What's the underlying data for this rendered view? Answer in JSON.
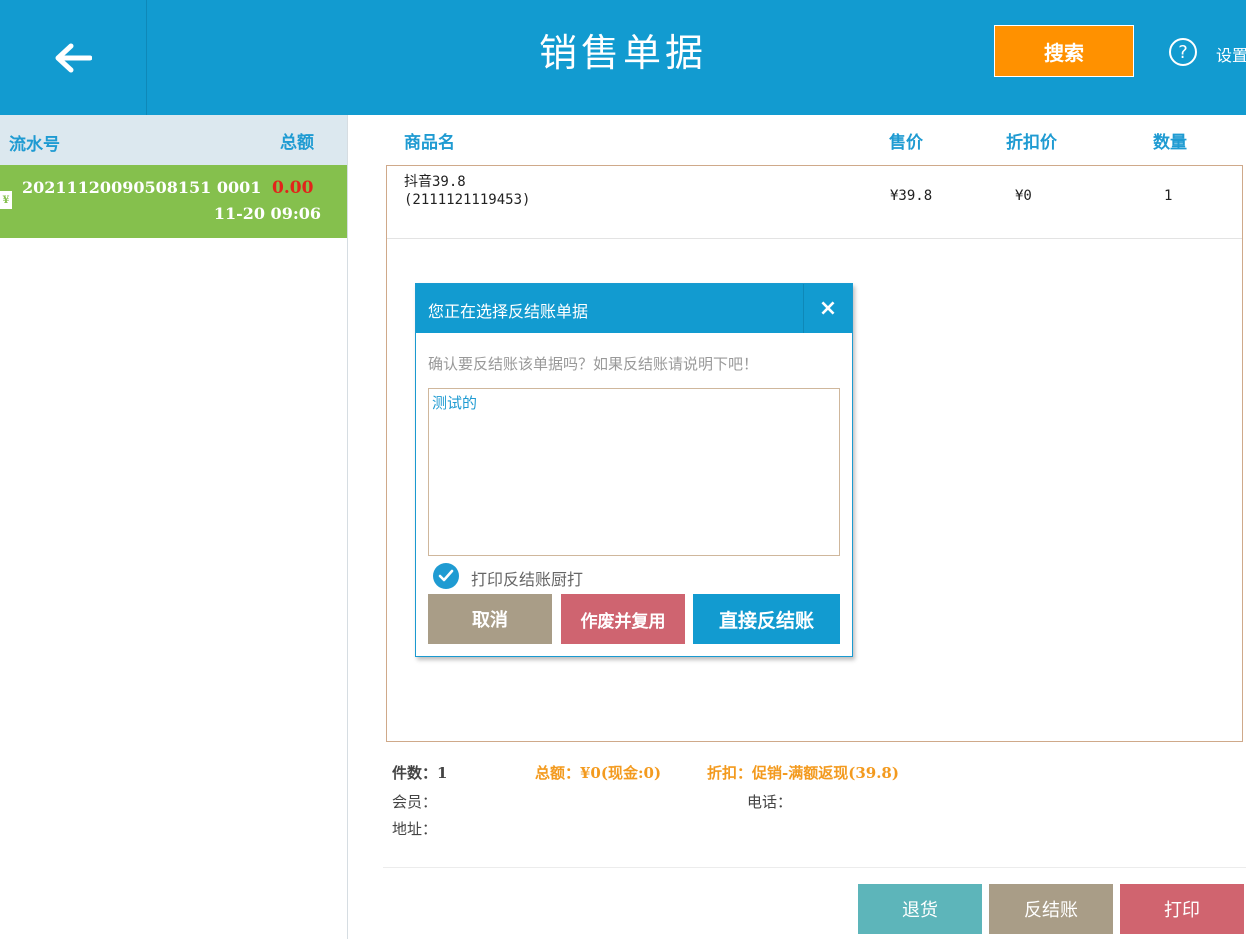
{
  "header": {
    "back_icon": "arrow-left-icon",
    "title": "销售单据",
    "search_label": "搜索",
    "help_icon": "question-circle-icon",
    "help_glyph": "?",
    "settings_label": "设置"
  },
  "list": {
    "columns": {
      "serial": "流水号",
      "total": "总额"
    },
    "rows": [
      {
        "icon": "receipt-yen-icon",
        "icon_glyph": "¥",
        "serial": "20211120090508151 0001",
        "amount": "0.00",
        "time": "11-20 09:06"
      }
    ]
  },
  "table": {
    "columns": {
      "name": "商品名",
      "price": "售价",
      "discount_price": "折扣价",
      "quantity": "数量"
    },
    "items": [
      {
        "name": "抖音39.8",
        "code": "(2111121119453)",
        "price": "¥39.8",
        "discount_price": "¥0",
        "quantity": "1"
      }
    ]
  },
  "dialog": {
    "title": "您正在选择反结账单据",
    "close_glyph": "×",
    "prompt": "确认要反结账该单据吗？如果反结账请说明下吧！",
    "textarea_value": "测试的",
    "checkbox_label": "打印反结账厨打",
    "checkbox_checked": true,
    "cancel_label": "取消",
    "void_label": "作废并复用",
    "reverse_label": "直接反结账"
  },
  "summary": {
    "count": "件数：1",
    "total": "总额：¥0(现金:0)",
    "discount": "折扣：促销-满额返现(39.8)",
    "member": "会员：",
    "phone": "电话：",
    "address": "地址："
  },
  "footer": {
    "return_label": "退货",
    "reverse_label": "反结账",
    "print_label": "打印"
  },
  "colors": {
    "header_bg": "#129bd0",
    "search_bg": "#ff9100",
    "row_selected_bg": "#85c04d",
    "amount_red": "#e2231a",
    "summary_orange": "#f39a1e"
  }
}
